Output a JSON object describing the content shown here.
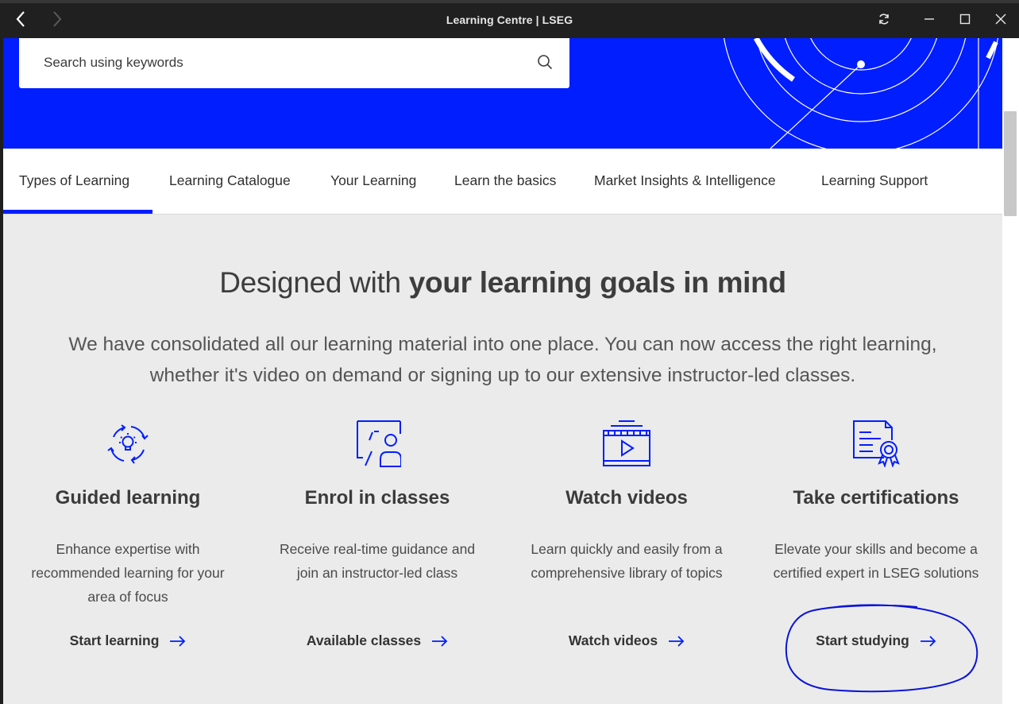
{
  "window": {
    "title": "Learning Centre | LSEG"
  },
  "search": {
    "placeholder": "Search using keywords",
    "icon": "search-icon"
  },
  "tabs": [
    {
      "label": "Types of Learning",
      "active": true
    },
    {
      "label": "Learning Catalogue",
      "active": false
    },
    {
      "label": "Your Learning",
      "active": false
    },
    {
      "label": "Learn the basics",
      "active": false
    },
    {
      "label": "Market Insights & Intelligence",
      "active": false
    },
    {
      "label": "Learning Support",
      "active": false
    }
  ],
  "main": {
    "headline_regular": "Designed with ",
    "headline_bold": "your learning goals in mind",
    "intro": "We have consolidated all our learning material into one place. You can now access the right learning, whether it's video on demand or signing up to our extensive instructor-led classes."
  },
  "cards": [
    {
      "icon": "refresh-lightbulb-icon",
      "title": "Guided learning",
      "description": "Enhance expertise with recommended learning for your area of focus",
      "link": "Start learning"
    },
    {
      "icon": "presenter-board-icon",
      "title": "Enrol in classes",
      "description": "Receive real-time guidance and join an instructor-led class",
      "link": "Available classes"
    },
    {
      "icon": "video-player-icon",
      "title": "Watch videos",
      "description": "Learn quickly and easily from a comprehensive library of topics",
      "link": "Watch videos"
    },
    {
      "icon": "certificate-icon",
      "title": "Take certifications",
      "description": "Elevate your skills and become a certified expert in LSEG solutions",
      "link": "Start studying"
    }
  ],
  "colors": {
    "brand": "#001eff",
    "page_bg": "#ebebeb",
    "titlebar": "#202020",
    "annotation": "#0b14d6"
  }
}
